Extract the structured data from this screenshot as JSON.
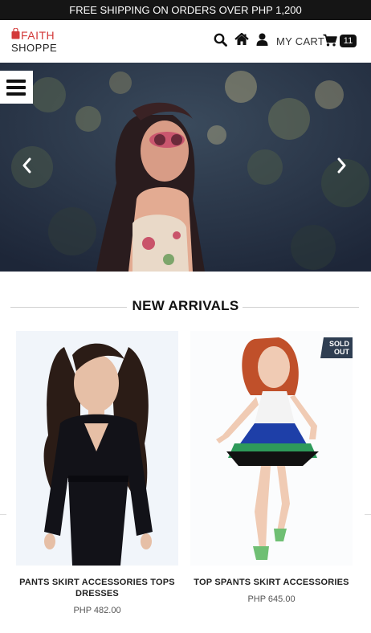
{
  "promo": {
    "text": "FREE SHIPPING ON ORDERS OVER PHP 1,200"
  },
  "header": {
    "logo_line1": "FAITH",
    "logo_line2": "SHOPPE",
    "cart_label": "MY CART",
    "cart_count": "11",
    "icons": [
      "search-icon",
      "home-icon",
      "user-icon",
      "cart-icon"
    ]
  },
  "hero": {
    "menu_icon": "hamburger-menu-icon",
    "prev_icon": "chevron-left-icon",
    "next_icon": "chevron-right-icon"
  },
  "section": {
    "title": "NEW ARRIVALS"
  },
  "products": [
    {
      "name": "PANTS SKIRT ACCESSORIES TOPS DRESSES",
      "price": "PHP 482.00"
    },
    {
      "name": "TOP SPANTS SKIRT ACCESSORIES",
      "price": "PHP 645.00",
      "badge": "SOLD OUT"
    }
  ],
  "colors": {
    "promo_bg": "#151515",
    "logo_accent": "#d33a3a",
    "badge_bg": "#2f3e52"
  }
}
